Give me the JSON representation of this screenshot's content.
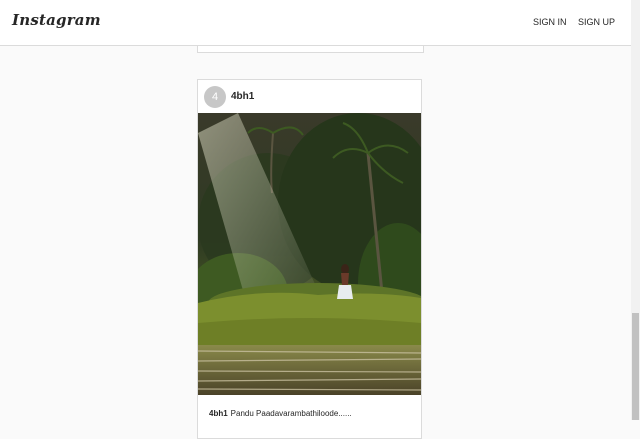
{
  "header": {
    "logo": "Instagram",
    "sign_in": "SIGN IN",
    "sign_up": "SIGN UP"
  },
  "post": {
    "avatar_text": "4",
    "username": "4bh1",
    "caption_user": "4bh1",
    "caption_text": "Pandu Paadavarambathiloode......"
  },
  "scroll": {
    "position_fraction": 1.0
  }
}
